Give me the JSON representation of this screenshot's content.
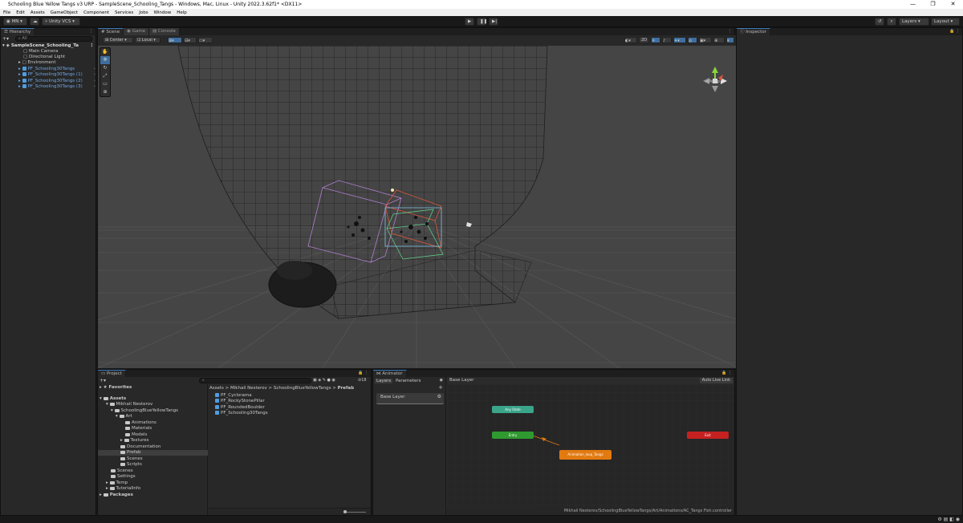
{
  "window": {
    "title": "Schooling Blue Yellow Tangs v3 URP - SampleScene_Schooling_Tangs - Windows, Mac, Linux - Unity 2022.3.62f1* <DX11>",
    "controls": [
      "—",
      "❐",
      "✕"
    ]
  },
  "menu": [
    "File",
    "Edit",
    "Assets",
    "GameObject",
    "Component",
    "Services",
    "Jobs",
    "Window",
    "Help"
  ],
  "toolbar": {
    "account": "MN",
    "vcs": "Unity VCS",
    "layers": "Layers",
    "layout": "Layout"
  },
  "hierarchy": {
    "tab": "Hierarchy",
    "search_placeholder": "All",
    "scene": "SampleScene_Schooling_Ta",
    "items": [
      {
        "label": "Main Camera",
        "type": "object"
      },
      {
        "label": "Directional Light",
        "type": "object"
      },
      {
        "label": "Environment",
        "type": "object"
      },
      {
        "label": "PF_Schooling30Tangs",
        "type": "prefab"
      },
      {
        "label": "PF_Schooling30Tangs (1)",
        "type": "prefab"
      },
      {
        "label": "PF_Schooling30Tangs (2)",
        "type": "prefab"
      },
      {
        "label": "PF_Schooling30Tangs (3)",
        "type": "prefab"
      }
    ]
  },
  "scene": {
    "tabs": [
      "Scene",
      "Game",
      "Console"
    ],
    "pivot": "Center",
    "space": "Local",
    "mode_2d": "2D",
    "persp_label": "<Persp"
  },
  "inspector": {
    "tab": "Inspector"
  },
  "project": {
    "tab": "Project",
    "item_count": "18",
    "favorites": "Favorites",
    "tree": [
      {
        "label": "Assets",
        "level": 0,
        "bold": true
      },
      {
        "label": "Mikhail Nesterov",
        "level": 1
      },
      {
        "label": "SchoolingBlueYellowTangs",
        "level": 2
      },
      {
        "label": "Art",
        "level": 3
      },
      {
        "label": "Animations",
        "level": 4
      },
      {
        "label": "Materials",
        "level": 4
      },
      {
        "label": "Models",
        "level": 4
      },
      {
        "label": "Textures",
        "level": 4
      },
      {
        "label": "Documentation",
        "level": 3
      },
      {
        "label": "Prefab",
        "level": 3,
        "selected": true
      },
      {
        "label": "Scenes",
        "level": 3
      },
      {
        "label": "Scripts",
        "level": 3
      },
      {
        "label": "Scenes",
        "level": 1
      },
      {
        "label": "Settings",
        "level": 1
      },
      {
        "label": "Temp",
        "level": 1
      },
      {
        "label": "TutorialInfo",
        "level": 1
      },
      {
        "label": "Packages",
        "level": 0,
        "bold": true
      }
    ],
    "breadcrumb": [
      "Assets",
      "Mikhail Nesterov",
      "SchoolingBlueYellowTangs",
      "Prefab"
    ],
    "assets": [
      "PF_Cyclorama",
      "PF_RockyStonePillar",
      "PF_RoundedBoulder",
      "PF_Schooling30Tangs"
    ]
  },
  "animator": {
    "tab": "Animator",
    "subtabs": [
      "Layers",
      "Parameters"
    ],
    "layer_name": "Base Layer",
    "breadcrumb": "Base Layer",
    "auto_live_link": "Auto Live Link",
    "nodes": {
      "any_state": "Any State",
      "entry": "Entry",
      "default_state": "Animation_loop_Tangs",
      "exit": "Exit"
    },
    "path": "Mikhail Nesterov/SchoolingBlueYellowTangs/Art/Animations/AC_Tangs Fish.controller"
  },
  "colors": {
    "prefab_text": "#6fa7e6",
    "any_state": "#3aa58a",
    "entry": "#2f9a2f",
    "default_state": "#e27a10",
    "exit": "#c62121"
  }
}
